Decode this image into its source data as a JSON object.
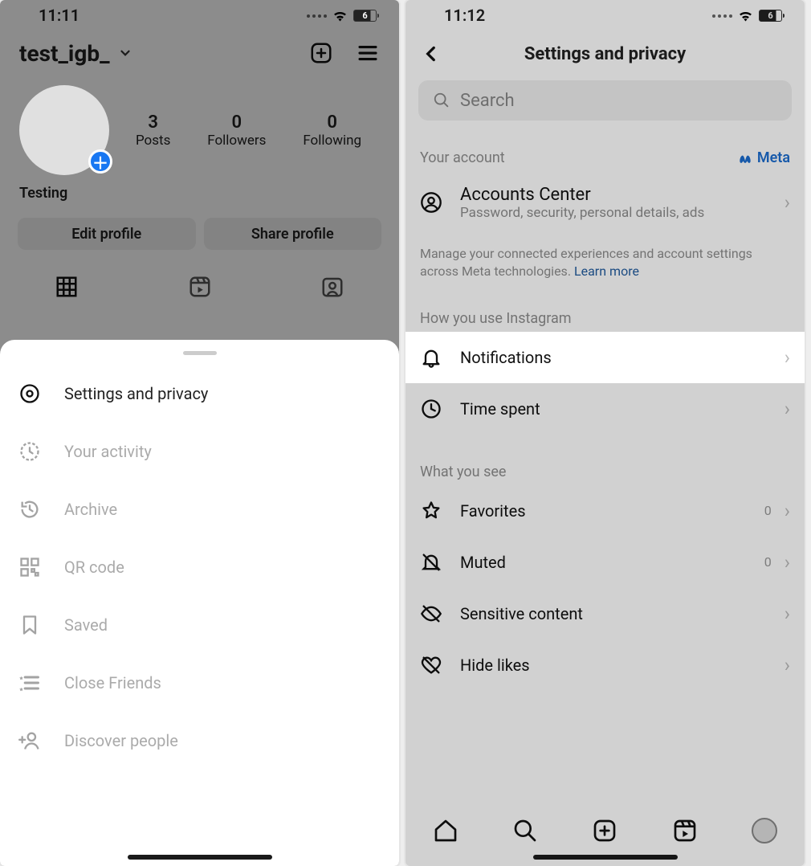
{
  "left": {
    "status": {
      "time": "11:11",
      "battery": "6"
    },
    "profile": {
      "username": "test_igb_",
      "display_name": "Testing",
      "stats": {
        "posts_n": "3",
        "posts_lbl": "Posts",
        "followers_n": "0",
        "followers_lbl": "Followers",
        "following_n": "0",
        "following_lbl": "Following"
      },
      "edit_btn": "Edit profile",
      "share_btn": "Share profile"
    },
    "sheet": {
      "items": [
        {
          "label": "Settings and privacy",
          "icon": "gear-icon",
          "highlight": true
        },
        {
          "label": "Your activity",
          "icon": "activity-icon",
          "highlight": false
        },
        {
          "label": "Archive",
          "icon": "history-icon",
          "highlight": false
        },
        {
          "label": "QR code",
          "icon": "qr-icon",
          "highlight": false
        },
        {
          "label": "Saved",
          "icon": "bookmark-icon",
          "highlight": false
        },
        {
          "label": "Close Friends",
          "icon": "closefriends-icon",
          "highlight": false
        },
        {
          "label": "Discover people",
          "icon": "addperson-icon",
          "highlight": false
        }
      ]
    }
  },
  "right": {
    "status": {
      "time": "11:12",
      "battery": "6"
    },
    "page_title": "Settings and privacy",
    "search_placeholder": "Search",
    "section1": {
      "header": "Your account",
      "brand": "Meta"
    },
    "accounts_center": {
      "title": "Accounts Center",
      "subtitle": "Password, security, personal details, ads"
    },
    "footnote": {
      "text": "Manage your connected experiences and account settings across Meta technologies. ",
      "link": "Learn more"
    },
    "section2": {
      "header": "How you use Instagram"
    },
    "rows2": [
      {
        "label": "Notifications",
        "icon": "bell-icon",
        "highlight": true
      },
      {
        "label": "Time spent",
        "icon": "clock-icon",
        "highlight": false
      }
    ],
    "section3": {
      "header": "What you see"
    },
    "rows3": [
      {
        "label": "Favorites",
        "icon": "star-icon",
        "tail": "0"
      },
      {
        "label": "Muted",
        "icon": "bell-off-icon",
        "tail": "0"
      },
      {
        "label": "Sensitive content",
        "icon": "eye-off-icon",
        "tail": ""
      },
      {
        "label": "Hide likes",
        "icon": "heart-off-icon",
        "tail": ""
      }
    ]
  }
}
